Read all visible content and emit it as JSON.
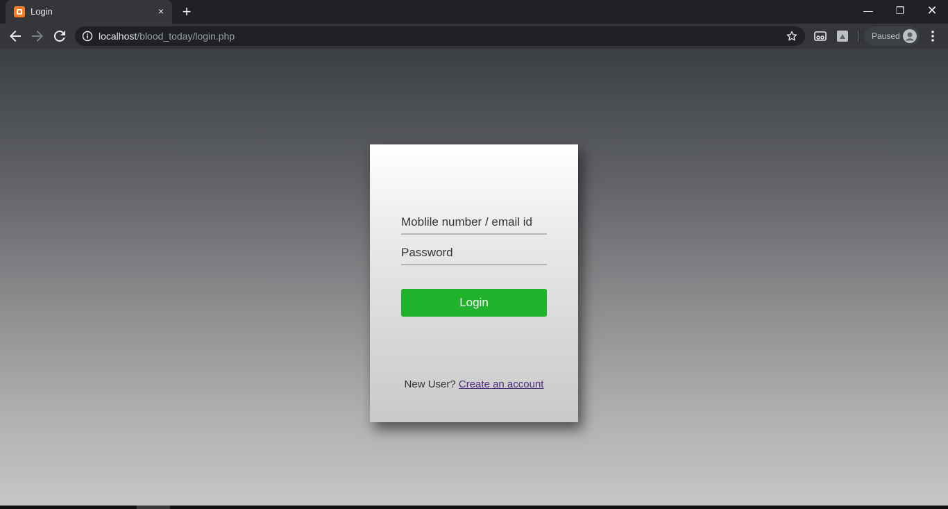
{
  "browser": {
    "tab_title": "Login",
    "tab_close": "×",
    "new_tab": "+",
    "url_host": "localhost",
    "url_path": "/blood_today/login.php",
    "profile_label": "Paused",
    "window_min": "—",
    "window_max": "❐",
    "window_close": "✕"
  },
  "form": {
    "email_placeholder": "Moblile number / email id",
    "password_placeholder": "Password",
    "login_label": "Login",
    "new_user_text": "New User? ",
    "create_account_link": "Create an account"
  },
  "colors": {
    "login_button": "#20b22a",
    "link": "#4b2a7f"
  }
}
